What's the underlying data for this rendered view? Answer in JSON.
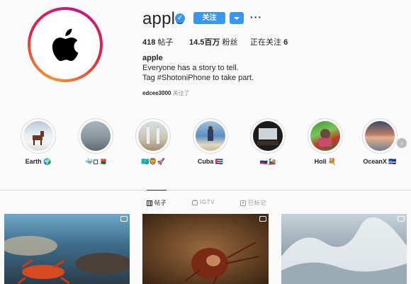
{
  "profile": {
    "username": "apple",
    "follow_label": "关注",
    "more_label": "···",
    "stats": {
      "posts_value": "418",
      "posts_label": "帖子",
      "followers_value": "14.5百万",
      "followers_label": "粉丝",
      "following_label": "正在关注",
      "following_value": "6"
    },
    "bio_name": "apple",
    "bio_line1": "Everyone has a story to tell.",
    "bio_line2": "Tag #ShotoniPhone to take part.",
    "followed_by_user": "edcee3000",
    "followed_by_suffix": "关注了"
  },
  "highlights": [
    {
      "label": "Earth 🌍"
    },
    {
      "label": "🐳◻🇲🇬"
    },
    {
      "label": "🇰🇿🦁🚀"
    },
    {
      "label": "Cuba 🇨🇺"
    },
    {
      "label": "🇷🇺🚂"
    },
    {
      "label": "Holi 💐"
    },
    {
      "label": "OceanX 🇨🇻"
    }
  ],
  "tabs": [
    {
      "label": "帖子"
    },
    {
      "label": "IGTV"
    },
    {
      "label": "已标记"
    }
  ],
  "colors": {
    "accent": "#3897f0",
    "text": "#262626",
    "muted": "#8e8e8e",
    "background": "#fafafa"
  }
}
